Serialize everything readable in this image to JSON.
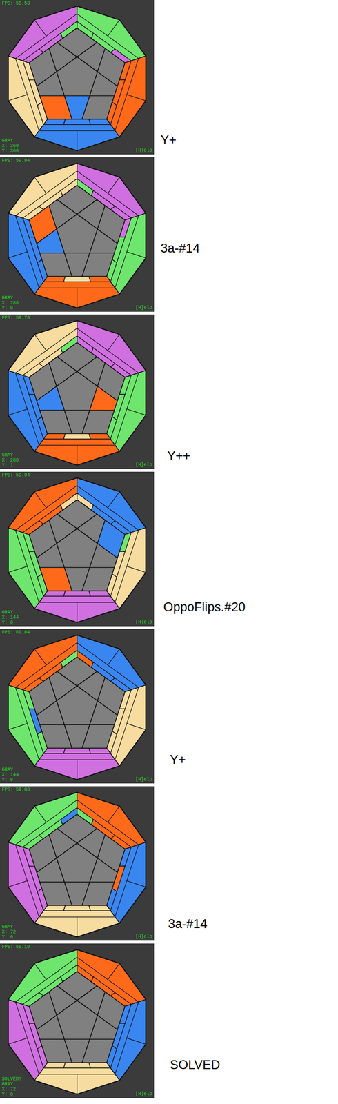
{
  "panels": [
    {
      "fps": "FPS: 58.53",
      "mode": "GRAY",
      "x": "X: 360",
      "y": "Y: 360",
      "help": "[H]elp",
      "caption": "Y+",
      "faces": [
        {
          "color": "#6ee66e",
          "strip": [
            "#6ee66e",
            "#6ee66e",
            "#d070e0"
          ]
        },
        {
          "color": "#ff6a1a",
          "strip": [
            "#ff6a1a",
            "#ff6a1a",
            "#ff6a1a"
          ]
        },
        {
          "color": "#3a86f0",
          "strip": [
            "#3a86f0",
            "#3a86f0",
            "#3a86f0"
          ]
        },
        {
          "color": "#f7dca0",
          "strip": [
            "#f7dca0",
            "#f7dca0",
            "#f7dca0"
          ]
        },
        {
          "color": "#d070e0",
          "strip": [
            "#d070e0",
            "#d070e0",
            "#6ee66e"
          ]
        }
      ],
      "corners": [
        "#808080",
        "#808080",
        "#808080",
        "#ff6a1a",
        "#808080"
      ],
      "edges": [
        "#808080",
        "#808080",
        "#3a86f0",
        "#808080",
        "#808080"
      ]
    },
    {
      "fps": "FPS: 59.94",
      "mode": "GRAY",
      "x": "X: 288",
      "y": "Y: 0",
      "help": "[H]elp",
      "caption": "3a-#14",
      "faces": [
        {
          "color": "#d070e0",
          "strip": [
            "#6ee66e",
            "#d070e0",
            "#d070e0"
          ]
        },
        {
          "color": "#6ee66e",
          "strip": [
            "#d070e0",
            "#6ee66e",
            "#6ee66e"
          ]
        },
        {
          "color": "#ff6a1a",
          "strip": [
            "#ff6a1a",
            "#f7dca0",
            "#ff6a1a"
          ]
        },
        {
          "color": "#3a86f0",
          "strip": [
            "#3a86f0",
            "#3a86f0",
            "#3a86f0"
          ]
        },
        {
          "color": "#f7dca0",
          "strip": [
            "#f7dca0",
            "#f7dca0",
            "#f7dca0"
          ]
        }
      ],
      "corners": [
        "#808080",
        "#808080",
        "#808080",
        "#808080",
        "#ff6a1a"
      ],
      "edges": [
        "#808080",
        "#808080",
        "#808080",
        "#3a86f0",
        "#808080"
      ]
    },
    {
      "fps": "FPS: 59.70",
      "mode": "GRAY",
      "x": "X: 288",
      "y": "Y: 1",
      "help": "[H]elp",
      "caption": "Y++",
      "faces": [
        {
          "color": "#d070e0",
          "strip": [
            "#d070e0",
            "#d070e0",
            "#d070e0"
          ]
        },
        {
          "color": "#6ee66e",
          "strip": [
            "#6ee66e",
            "#6ee66e",
            "#6ee66e"
          ]
        },
        {
          "color": "#ff6a1a",
          "strip": [
            "#ff6a1a",
            "#f7dca0",
            "#ff6a1a"
          ]
        },
        {
          "color": "#3a86f0",
          "strip": [
            "#3a86f0",
            "#3a86f0",
            "#3a86f0"
          ]
        },
        {
          "color": "#f7dca0",
          "strip": [
            "#f7dca0",
            "#f7dca0",
            "#6ee66e"
          ]
        }
      ],
      "corners": [
        "#808080",
        "#808080",
        "#808080",
        "#808080",
        "#808080"
      ],
      "edges": [
        "#808080",
        "#ff6a1a",
        "#808080",
        "#3a86f0",
        "#808080"
      ]
    },
    {
      "fps": "FPS: 59.94",
      "mode": "GRAY",
      "x": "X: 144",
      "y": "Y: 0",
      "help": "[H]elp",
      "caption": "OppoFlips.#20",
      "faces": [
        {
          "color": "#3a86f0",
          "strip": [
            "#f7dca0",
            "#3a86f0",
            "#3a86f0"
          ]
        },
        {
          "color": "#f7dca0",
          "strip": [
            "#6ee66e",
            "#f7dca0",
            "#f7dca0"
          ]
        },
        {
          "color": "#d070e0",
          "strip": [
            "#d070e0",
            "#d070e0",
            "#d070e0"
          ]
        },
        {
          "color": "#6ee66e",
          "strip": [
            "#6ee66e",
            "#6ee66e",
            "#6ee66e"
          ]
        },
        {
          "color": "#ff6a1a",
          "strip": [
            "#ff6a1a",
            "#ff6a1a",
            "#f7dca0"
          ]
        }
      ],
      "corners": [
        "#808080",
        "#3a86f0",
        "#808080",
        "#ff6a1a",
        "#808080"
      ],
      "edges": [
        "#808080",
        "#808080",
        "#808080",
        "#808080",
        "#808080"
      ]
    },
    {
      "fps": "FPS: 60.04",
      "mode": "GRAY",
      "x": "X: 144",
      "y": "Y: 0",
      "help": "[H]elp",
      "caption": "Y+",
      "faces": [
        {
          "color": "#3a86f0",
          "strip": [
            "#ff6a1a",
            "#3a86f0",
            "#3a86f0"
          ]
        },
        {
          "color": "#f7dca0",
          "strip": [
            "#f7dca0",
            "#f7dca0",
            "#f7dca0"
          ]
        },
        {
          "color": "#d070e0",
          "strip": [
            "#d070e0",
            "#d070e0",
            "#d070e0"
          ]
        },
        {
          "color": "#6ee66e",
          "strip": [
            "#6ee66e",
            "#3a86f0",
            "#6ee66e"
          ]
        },
        {
          "color": "#ff6a1a",
          "strip": [
            "#ff6a1a",
            "#ff6a1a",
            "#6ee66e"
          ]
        }
      ],
      "corners": [
        "#808080",
        "#808080",
        "#808080",
        "#808080",
        "#808080"
      ],
      "edges": [
        "#808080",
        "#808080",
        "#808080",
        "#808080",
        "#808080"
      ]
    },
    {
      "fps": "FPS: 59.88",
      "mode": "GRAY",
      "x": "X: 72",
      "y": "Y: 0",
      "help": "[H]elp",
      "caption": "3a-#14",
      "faces": [
        {
          "color": "#ff6a1a",
          "strip": [
            "#6ee66e",
            "#ff6a1a",
            "#ff6a1a"
          ]
        },
        {
          "color": "#3a86f0",
          "strip": [
            "#3a86f0",
            "#ff6a1a",
            "#3a86f0"
          ]
        },
        {
          "color": "#f7dca0",
          "strip": [
            "#f7dca0",
            "#f7dca0",
            "#f7dca0"
          ]
        },
        {
          "color": "#d070e0",
          "strip": [
            "#d070e0",
            "#d070e0",
            "#d070e0"
          ]
        },
        {
          "color": "#6ee66e",
          "strip": [
            "#6ee66e",
            "#6ee66e",
            "#3a86f0"
          ]
        }
      ],
      "corners": [
        "#808080",
        "#808080",
        "#808080",
        "#808080",
        "#808080"
      ],
      "edges": [
        "#808080",
        "#808080",
        "#808080",
        "#808080",
        "#808080"
      ]
    },
    {
      "fps": "FPS: 60.10",
      "status": "SOLVED!",
      "mode": "GRAY",
      "x": "X: 72",
      "y": "Y: 0",
      "help": "[H]elp",
      "caption": "SOLVED",
      "faces": [
        {
          "color": "#ff6a1a",
          "strip": [
            "#ff6a1a",
            "#ff6a1a",
            "#ff6a1a"
          ]
        },
        {
          "color": "#3a86f0",
          "strip": [
            "#3a86f0",
            "#3a86f0",
            "#3a86f0"
          ]
        },
        {
          "color": "#f7dca0",
          "strip": [
            "#f7dca0",
            "#f7dca0",
            "#f7dca0"
          ]
        },
        {
          "color": "#d070e0",
          "strip": [
            "#d070e0",
            "#d070e0",
            "#d070e0"
          ]
        },
        {
          "color": "#6ee66e",
          "strip": [
            "#6ee66e",
            "#6ee66e",
            "#6ee66e"
          ]
        }
      ],
      "corners": [
        "#808080",
        "#808080",
        "#808080",
        "#808080",
        "#808080"
      ],
      "edges": [
        "#808080",
        "#808080",
        "#808080",
        "#808080",
        "#808080"
      ]
    }
  ]
}
